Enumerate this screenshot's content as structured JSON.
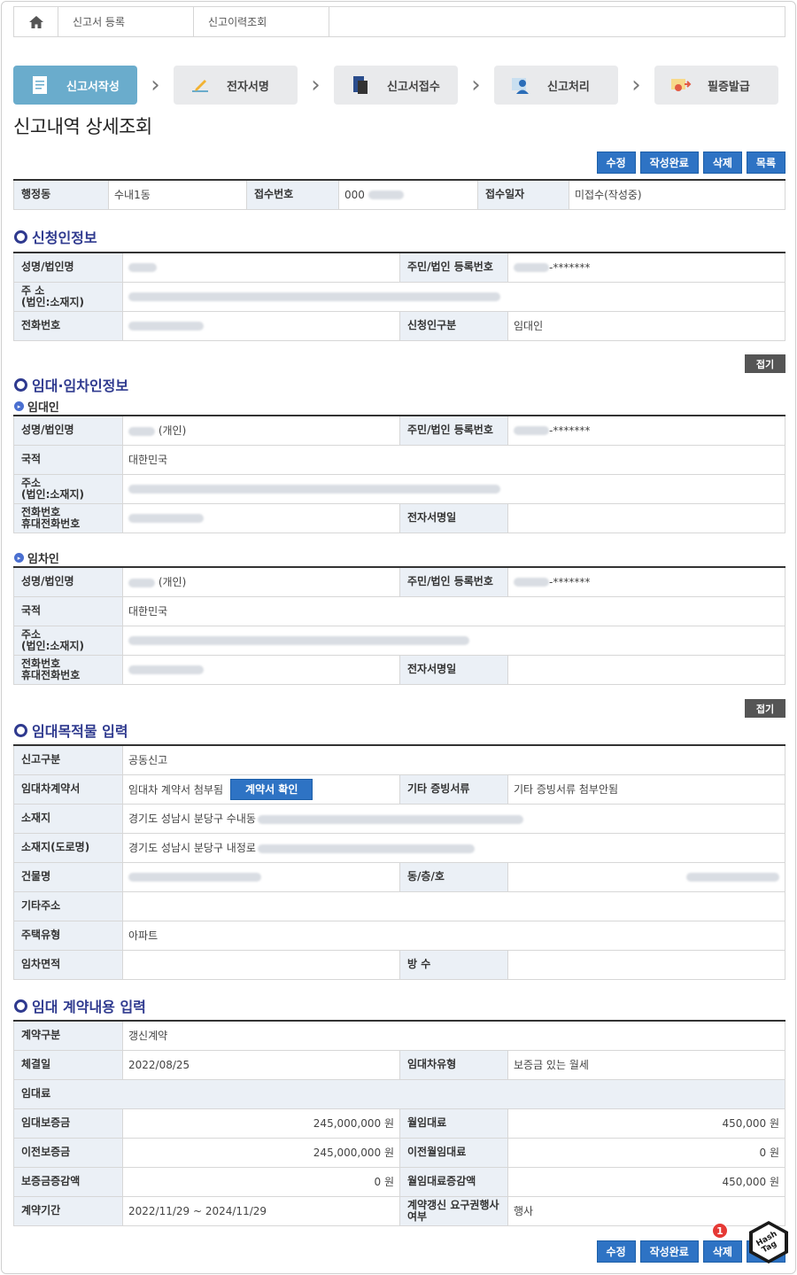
{
  "breadcrumb": [
    "신고서 등록",
    "신고이력조회"
  ],
  "steps": [
    {
      "label": "신고서작성",
      "icon": "document-icon",
      "active": true
    },
    {
      "label": "전자서명",
      "icon": "pen-sign-icon",
      "active": false
    },
    {
      "label": "신고서접수",
      "icon": "file-submit-icon",
      "active": false
    },
    {
      "label": "신고처리",
      "icon": "person-process-icon",
      "active": false
    },
    {
      "label": "필증발급",
      "icon": "certificate-icon",
      "active": false
    }
  ],
  "page_title": "신고내역 상세조회",
  "actions": {
    "edit": "수정",
    "complete": "작성완료",
    "delete": "삭제",
    "list": "목록"
  },
  "summary": {
    "dong_label": "행정동",
    "dong_value": "수내1동",
    "receipt_no_label": "접수번호",
    "receipt_no_value": "000",
    "receipt_date_label": "접수일자",
    "receipt_date_value": "미접수(작성중)"
  },
  "applicant": {
    "title": "신청인정보",
    "name_label": "성명/법인명",
    "rrn_label": "주민/법인 등록번호",
    "rrn_mask": "-*******",
    "addr_label_1": "주  소",
    "addr_label_2": "(법인:소재지)",
    "phone_label": "전화번호",
    "type_label": "신청인구분",
    "type_value": "임대인"
  },
  "fold_label": "접기",
  "parties": {
    "title": "임대·임차인정보",
    "lessor_title": "임대인",
    "lessee_title": "임차인",
    "name_label": "성명/법인명",
    "individual": "(개인)",
    "rrn_label": "주민/법인 등록번호",
    "rrn_mask": "-*******",
    "nation_label": "국적",
    "nation_value": "대한민국",
    "addr_label_1": "주소",
    "addr_label_2": "(법인:소재지)",
    "phone_label_1": "전화번호",
    "phone_label_2": "휴대전화번호",
    "esign_label": "전자서명일"
  },
  "property": {
    "title": "임대목적물 입력",
    "report_type_label": "신고구분",
    "report_type_value": "공동신고",
    "contract_label": "임대차계약서",
    "contract_value": "임대차 계약서 첨부됨",
    "contract_btn": "계약서 확인",
    "other_docs_label": "기타 증빙서류",
    "other_docs_value": "기타 증빙서류 첨부안됨",
    "location_label": "소재지",
    "location_value": "경기도 성남시 분당구 수내동",
    "road_label": "소재지(도로명)",
    "road_value": "경기도 성남시 분당구 내정로",
    "building_label": "건물명",
    "unit_label": "동/층/호",
    "etc_addr_label": "기타주소",
    "house_type_label": "주택유형",
    "house_type_value": "아파트",
    "area_label": "임차면적",
    "rooms_label": "방 수"
  },
  "contract": {
    "title": "임대 계약내용 입력",
    "kind_label": "계약구분",
    "kind_value": "갱신계약",
    "date_label": "체결일",
    "date_value": "2022/08/25",
    "lease_type_label": "임대차유형",
    "lease_type_value": "보증금 있는 월세",
    "rent_section": "임대료",
    "deposit_label": "임대보증금",
    "deposit_value": "245,000,000 원",
    "monthly_label": "월임대료",
    "monthly_value": "450,000 원",
    "prev_deposit_label": "이전보증금",
    "prev_deposit_value": "245,000,000 원",
    "prev_monthly_label": "이전월임대료",
    "prev_monthly_value": "0 원",
    "deposit_diff_label": "보증금증감액",
    "deposit_diff_value": "0 원",
    "monthly_diff_label": "월임대료증감액",
    "monthly_diff_value": "450,000 원",
    "period_label": "계약기간",
    "period_value": "2022/11/29 ~ 2024/11/29",
    "renewal_label_1": "계약갱신 요구권행사",
    "renewal_label_2": "여부",
    "renewal_value": "행사"
  },
  "badge_number": "1",
  "logo_text": "Hash Tag"
}
